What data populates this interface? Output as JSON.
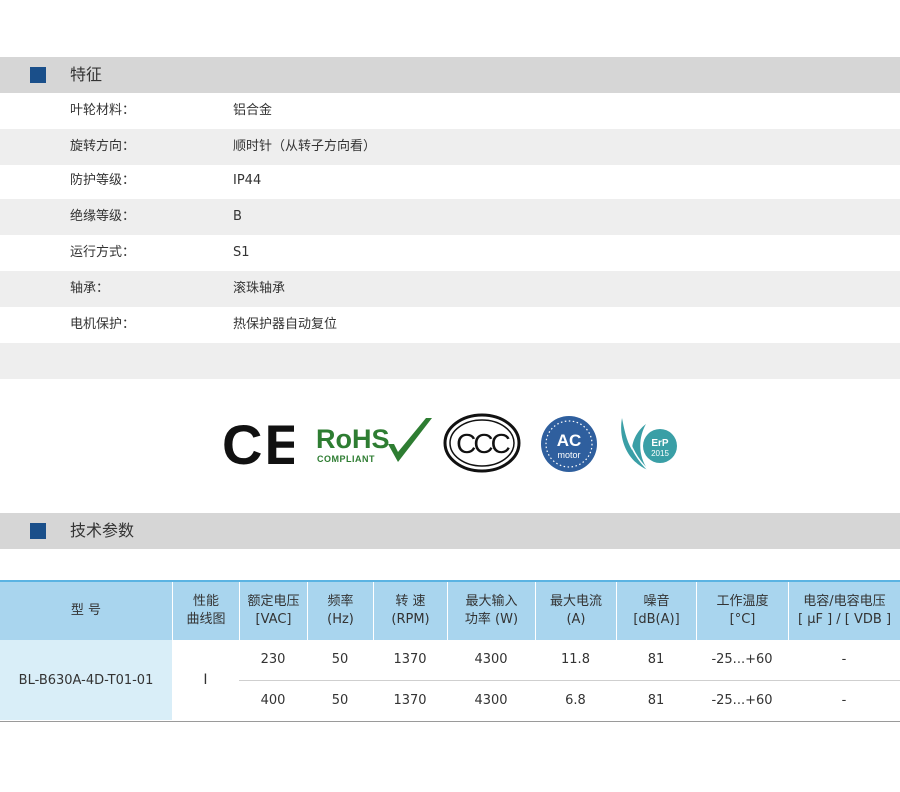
{
  "features": {
    "heading": "特征",
    "rows": [
      {
        "label": "叶轮材料：",
        "value": "铝合金"
      },
      {
        "label": "旋转方向：",
        "value": "顺时针（从转子方向看）"
      },
      {
        "label": "防护等级：",
        "value": "IP44"
      },
      {
        "label": "绝缘等级：",
        "value": "B"
      },
      {
        "label": "运行方式：",
        "value": "S1"
      },
      {
        "label": "轴承：",
        "value": "滚珠轴承"
      },
      {
        "label": "电机保护：",
        "value": "热保护器自动复位"
      }
    ]
  },
  "certifications": {
    "ce": "CE",
    "rohs": "RoHS",
    "rohs_sub": "COMPLIANT",
    "ccc": "CCC",
    "ac_line1": "AC",
    "ac_line2": "motor",
    "erp_line1": "ErP",
    "erp_line2": "2015"
  },
  "parameters": {
    "heading": "技术参数",
    "headers": [
      {
        "l1": "型  号",
        "l2": ""
      },
      {
        "l1": "性能",
        "l2": "曲线图"
      },
      {
        "l1": "额定电压",
        "l2": "[VAC]"
      },
      {
        "l1": "频率",
        "l2": "(Hz)"
      },
      {
        "l1": "转 速",
        "l2": "(RPM)"
      },
      {
        "l1": "最大输入",
        "l2": "功率 (W)"
      },
      {
        "l1": "最大电流",
        "l2": "(A)"
      },
      {
        "l1": "噪音",
        "l2": "[dB(A)]"
      },
      {
        "l1": "工作温度",
        "l2": "[°C]"
      },
      {
        "l1": "电容/电容电压",
        "l2": "[ μF ] / [ VDB ]"
      }
    ],
    "model": "BL-B630A-4D-T01-01",
    "curve": "I",
    "rows": [
      {
        "voltage": "230",
        "freq": "50",
        "rpm": "1370",
        "power": "4300",
        "current": "11.8",
        "noise": "81",
        "temp": "-25...+60",
        "cap": "-"
      },
      {
        "voltage": "400",
        "freq": "50",
        "rpm": "1370",
        "power": "4300",
        "current": "6.8",
        "noise": "81",
        "temp": "-25...+60",
        "cap": "-"
      }
    ]
  }
}
